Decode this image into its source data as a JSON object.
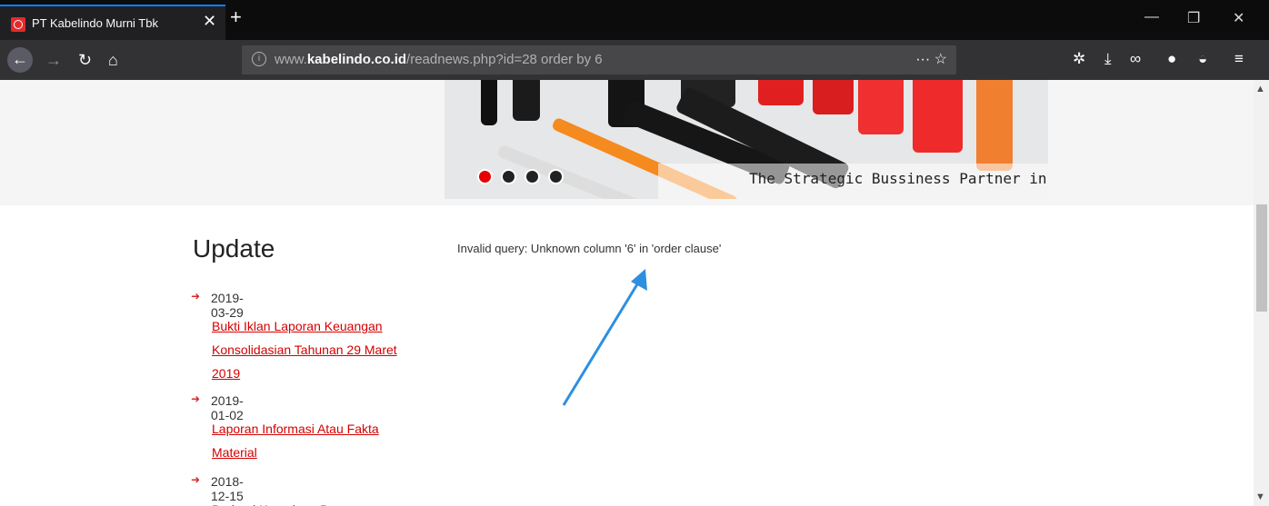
{
  "browser": {
    "tab_title": "PT Kabelindo Murni Tbk",
    "new_tab_label": "+",
    "tab_close": "✕",
    "url_prefix": "www.",
    "url_domain": "kabelindo.co.id",
    "url_path": "/readnews.php?id=28 order by 6",
    "page_actions": "···  ☆",
    "info_icon": "i",
    "window_controls": [
      "—",
      "❐",
      "✕"
    ]
  },
  "hero": {
    "caption": "The Strategic Bussiness Partner in",
    "slides": 4,
    "active_slide": 1
  },
  "sidebar": {
    "heading": "Update",
    "news": [
      {
        "date": "2019-03-29",
        "title": "Bukti Iklan Laporan Keuangan Konsolidasian Tahunan 29 Maret 2019"
      },
      {
        "date": "2019-01-02",
        "title": "Laporan Informasi Atau Fakta Material"
      },
      {
        "date": "2018-12-15",
        "title": "Berbagi Keceriaan Dengan"
      }
    ]
  },
  "main": {
    "error_message": "Invalid query: Unknown column '6' in 'order clause'"
  },
  "colors": {
    "accent_red": "#d40000",
    "arrow_blue": "#2e8fe0",
    "toolbar_dark": "#323234"
  }
}
